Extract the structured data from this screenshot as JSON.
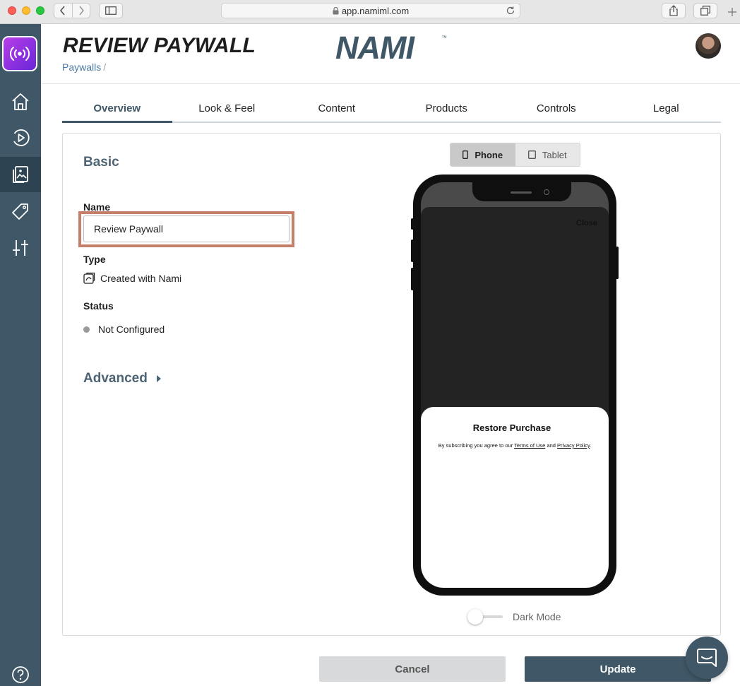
{
  "browser": {
    "url": "app.namiml.com"
  },
  "header": {
    "title": "REVIEW PAYWALL",
    "breadcrumb_link": "Paywalls",
    "breadcrumb_sep": "/",
    "brand": "NAMI",
    "brand_tm": "™"
  },
  "tabs": [
    {
      "label": "Overview",
      "active": true
    },
    {
      "label": "Look & Feel"
    },
    {
      "label": "Content"
    },
    {
      "label": "Products"
    },
    {
      "label": "Controls"
    },
    {
      "label": "Legal"
    }
  ],
  "form": {
    "section_title": "Basic",
    "name_label": "Name",
    "name_value": "Review Paywall",
    "type_label": "Type",
    "type_value": "Created with Nami",
    "status_label": "Status",
    "status_value": "Not Configured",
    "advanced_label": "Advanced"
  },
  "preview": {
    "device_options": [
      "Phone",
      "Tablet"
    ],
    "selected_device": "Phone",
    "close_text": "Close",
    "sheet_title": "Restore Purchase",
    "legal_prefix": "By subscribing you agree to our",
    "terms_link": "Terms of Use",
    "legal_and": "and",
    "privacy_link": "Privacy Policy",
    "legal_suffix": ".",
    "dark_mode_label": "Dark Mode",
    "dark_mode_on": false
  },
  "actions": {
    "cancel": "Cancel",
    "update": "Update"
  },
  "colors": {
    "sidebar": "#3f5766",
    "accent": "#3f5766",
    "link": "#4a7aa6",
    "highlight_border": "#c5806a",
    "logo_gradient_start": "#b73ee8",
    "logo_gradient_end": "#6a26d8"
  },
  "icons": {
    "nav": [
      "home-icon",
      "play-icon",
      "paywall-icon",
      "tag-icon",
      "sliders-icon",
      "help-icon"
    ]
  }
}
